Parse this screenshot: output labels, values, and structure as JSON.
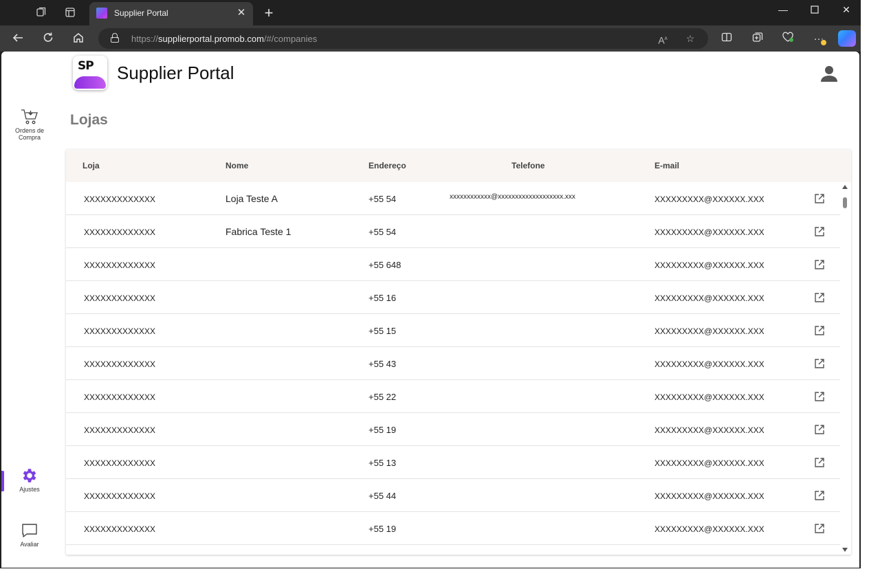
{
  "browser": {
    "tab_title": "Supplier Portal",
    "url_scheme": "https://",
    "url_host": "supplierportal.promob.com",
    "url_path": "/#/companies"
  },
  "app": {
    "title": "Supplier Portal",
    "logo_text": "SP",
    "accent_color": "#7b3fe4"
  },
  "sidebar": {
    "items": [
      {
        "label": "Ordens de Compra",
        "icon": "cart-icon",
        "active": false
      },
      {
        "label": "Ajustes",
        "icon": "gear-icon",
        "active": true
      },
      {
        "label": "Avaliar",
        "icon": "chat-bubble-icon",
        "active": false
      }
    ]
  },
  "page": {
    "title": "Lojas"
  },
  "table": {
    "columns": [
      "Loja",
      "Nome",
      "Endereço",
      "Telefone",
      "E-mail"
    ],
    "rows": [
      {
        "loja": "XXXXXXXXXXXXX",
        "nome": "Loja Teste A",
        "endereco": "+55 54",
        "telefone": "xxxxxxxxxxxx@xxxxxxxxxxxxxxxxxxx.xxx",
        "email": "XXXXXXXXX@XXXXXX.XXX"
      },
      {
        "loja": "XXXXXXXXXXXXX",
        "nome": "Fabrica Teste 1",
        "endereco": "+55 54",
        "telefone": "",
        "email": "XXXXXXXXX@XXXXXX.XXX"
      },
      {
        "loja": "XXXXXXXXXXXXX",
        "nome": "",
        "endereco": "+55 648",
        "telefone": "",
        "email": "XXXXXXXXX@XXXXXX.XXX"
      },
      {
        "loja": "XXXXXXXXXXXXX",
        "nome": "",
        "endereco": "+55 16",
        "telefone": "",
        "email": "XXXXXXXXX@XXXXXX.XXX"
      },
      {
        "loja": "XXXXXXXXXXXXX",
        "nome": "",
        "endereco": "+55 15",
        "telefone": "",
        "email": "XXXXXXXXX@XXXXXX.XXX"
      },
      {
        "loja": "XXXXXXXXXXXXX",
        "nome": "",
        "endereco": "+55 43",
        "telefone": "",
        "email": "XXXXXXXXX@XXXXXX.XXX"
      },
      {
        "loja": "XXXXXXXXXXXXX",
        "nome": "",
        "endereco": "+55 22",
        "telefone": "",
        "email": "XXXXXXXXX@XXXXXX.XXX"
      },
      {
        "loja": "XXXXXXXXXXXXX",
        "nome": "",
        "endereco": "+55 19",
        "telefone": "",
        "email": "XXXXXXXXX@XXXXXX.XXX"
      },
      {
        "loja": "XXXXXXXXXXXXX",
        "nome": "",
        "endereco": "+55 13",
        "telefone": "",
        "email": "XXXXXXXXX@XXXXXX.XXX"
      },
      {
        "loja": "XXXXXXXXXXXXX",
        "nome": "",
        "endereco": "+55 44",
        "telefone": "",
        "email": "XXXXXXXXX@XXXXXX.XXX"
      },
      {
        "loja": "XXXXXXXXXXXXX",
        "nome": "",
        "endereco": "+55 19",
        "telefone": "",
        "email": "XXXXXXXXX@XXXXXX.XXX"
      }
    ]
  }
}
